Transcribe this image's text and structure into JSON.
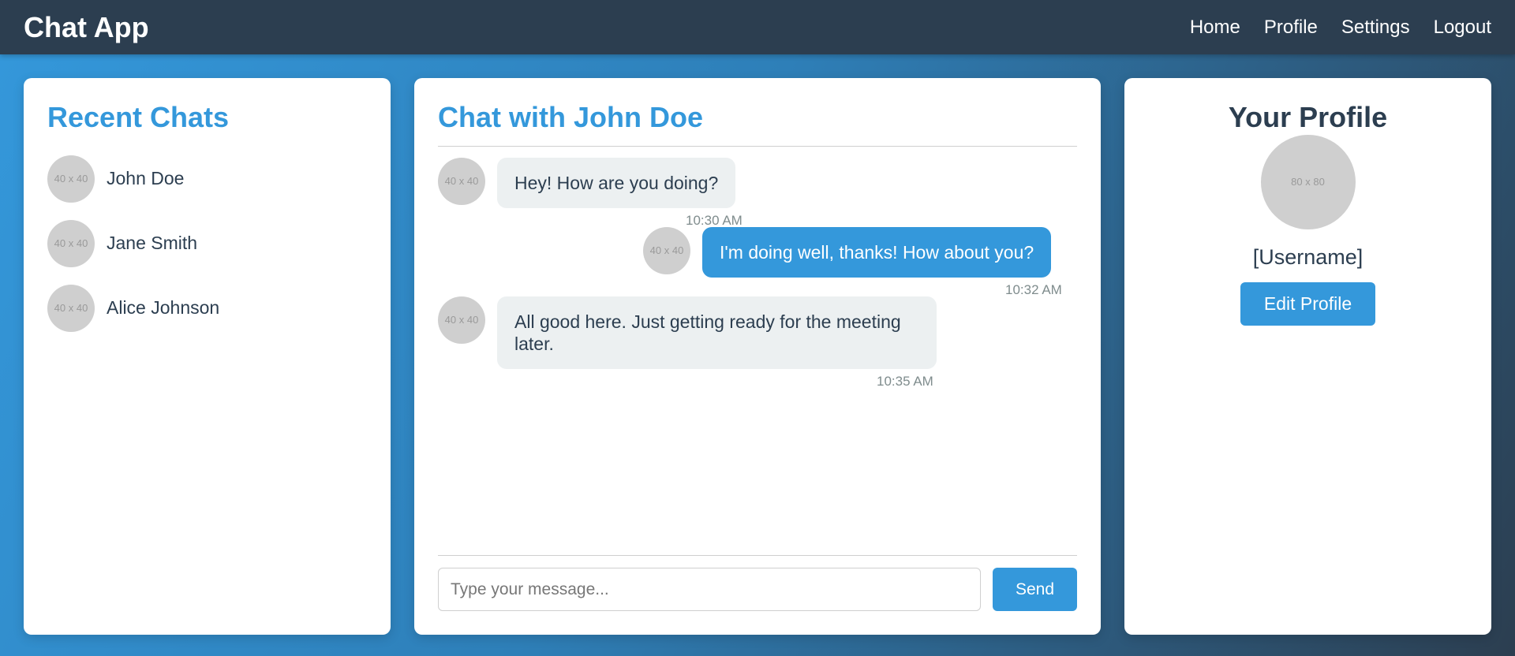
{
  "nav": {
    "brand": "Chat App",
    "links": [
      "Home",
      "Profile",
      "Settings",
      "Logout"
    ]
  },
  "recent_chats": {
    "title": "Recent Chats",
    "avatar_label": "40 x 40",
    "items": [
      "John Doe",
      "Jane Smith",
      "Alice Johnson"
    ]
  },
  "chat": {
    "title": "Chat with John Doe",
    "avatar_label": "40 x 40",
    "messages": [
      {
        "direction": "received",
        "text": "Hey! How are you doing?",
        "time": "10:30 AM"
      },
      {
        "direction": "sent",
        "text": "I'm doing well, thanks! How about you?",
        "time": "10:32 AM"
      },
      {
        "direction": "received",
        "text": "All good here. Just getting ready for the meeting later.",
        "time": "10:35 AM"
      }
    ],
    "input_placeholder": "Type your message...",
    "input_value": "",
    "send_label": "Send"
  },
  "profile": {
    "title": "Your Profile",
    "avatar_label": "80 x 80",
    "username": "[Username]",
    "edit_label": "Edit Profile"
  },
  "colors": {
    "accent": "#3498db",
    "navbar": "#2c3e50",
    "received_bubble": "#ecf0f1",
    "text": "#2c3e50"
  }
}
